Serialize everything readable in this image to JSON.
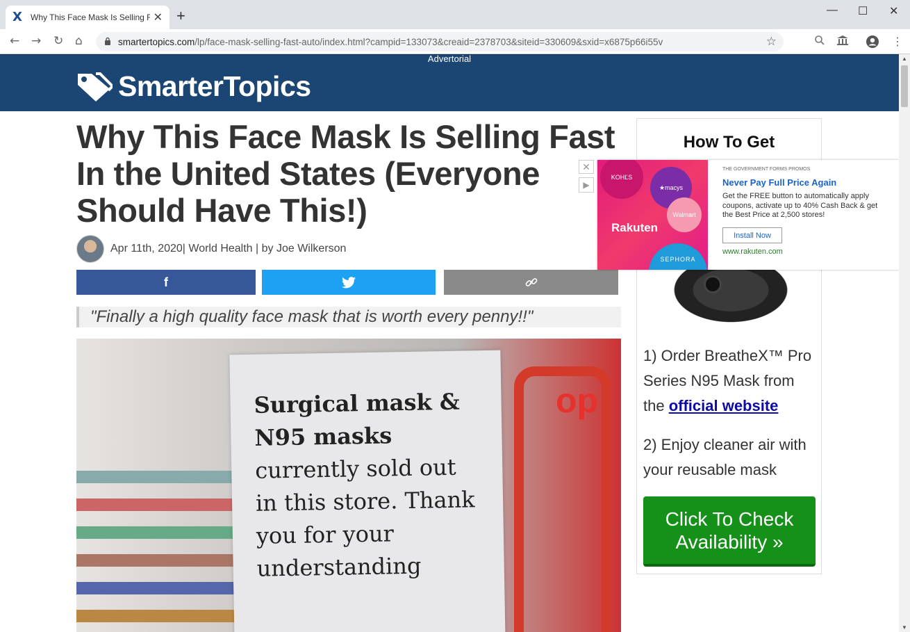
{
  "browser": {
    "tab_title": "Why This Face Mask Is Selling Fa",
    "tab_favicon": "X",
    "new_tab": "+",
    "url_host": "smartertopics.com",
    "url_path": "/lp/face-mask-selling-fast-auto/index.html?campid=133073&creaid=2378703&siteid=330609&sxid=x6875p66i55v",
    "minimize": "—",
    "maximize": "☐",
    "close": "✕",
    "back": "←",
    "forward": "→",
    "reload": "↻",
    "home": "⌂",
    "star": "☆",
    "zoom": "🔍",
    "menu": "⋮"
  },
  "header": {
    "advertorial": "Advertorial",
    "logo_text": "SmarterTopics"
  },
  "article": {
    "headline": "Why This Face Mask Is Selling Fast In the United States (Everyone Should Have This!)",
    "byline": "Apr 11th, 2020| World Health | by Joe Wilkerson",
    "share_facebook": "f",
    "share_twitter": "🐦",
    "share_link": "🔗",
    "quote": "\"Finally a high quality face mask that is worth every penny!!\"",
    "photo_sign_line1": "Surgical mask &",
    "photo_sign_line2": "N95 masks",
    "photo_sign_line3": "currently sold out",
    "photo_sign_line4": "in this store. Thank",
    "photo_sign_line5": "you for your",
    "photo_sign_line6": "understanding"
  },
  "sidebar": {
    "title": "How To Get",
    "step1_prefix": "1) Order BreatheX™ Pro Series N95 Mask from the ",
    "step1_link": "official website",
    "step2": "2) Enjoy cleaner air with your reusable mask",
    "cta": "Click To Check Availability »"
  },
  "popup_ad": {
    "source": "THE GOVERNMENT FORMS PROMOS",
    "title": "Never Pay Full Price Again",
    "description": "Get the FREE button to automatically apply coupons, activate up to 40% Cash Back & get the Best Price at 2,500 stores!",
    "button": "Install Now",
    "url": "www.rakuten.com",
    "img_kohls": "KOHĽS",
    "img_macys": "★macys",
    "img_walmart": "Walmart",
    "img_rakuten": "Rakuten",
    "img_sephora": "SEPHORA",
    "close": "✕",
    "adchoice": "▶"
  },
  "colors": {
    "header_bg": "#1b4572",
    "facebook": "#365899",
    "twitter": "#1da1f2",
    "link": "#8a8a8a",
    "cta": "#159018"
  }
}
